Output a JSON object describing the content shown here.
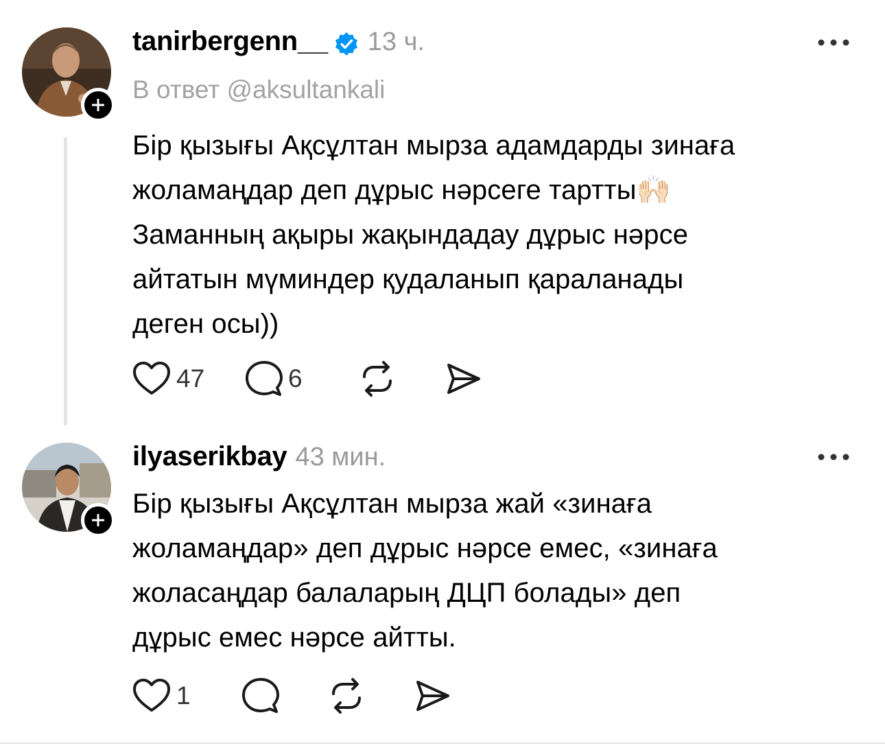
{
  "posts": [
    {
      "username": "tanirbergenn__",
      "verified": true,
      "time": "13 ч.",
      "reply_to": "В ответ @aksultankali",
      "lines": [
        "Бір қызығы Ақсұлтан мырза адамдарды зинаға",
        "жоламаңдар деп дұрыс нәрсеге тартты🙌🏻",
        "Заманның ақыры жақындадау дұрыс нәрсе",
        "айтатын мүминдер қудаланып қараланады",
        "деген осы))"
      ],
      "likes": "47",
      "comments": "6",
      "avatar_icon": "avatar-man-suit",
      "colors": {
        "avatar_bg": "#5a4230",
        "avatar_fg": "#8a5a36"
      }
    },
    {
      "username": "ilyaserikbay",
      "verified": false,
      "time": "43 мин.",
      "lines": [
        "Бір қызығы Ақсұлтан мырза жай «зинаға",
        "жоламаңдар» деп дұрыс нәрсе емес, «зинаға",
        "жоласаңдар балаларың ДЦП болады» деп",
        "дұрыс емес нәрсе айтты."
      ],
      "likes": "1",
      "comments": "",
      "avatar_icon": "avatar-man-street",
      "colors": {
        "avatar_bg": "#c8c4bc",
        "avatar_fg": "#2a2a2a"
      }
    }
  ],
  "icons": {
    "like": "heart-icon",
    "comment": "comment-bubble-icon",
    "repost": "repost-icon",
    "share": "share-send-icon",
    "more": "more-dots-icon",
    "follow": "plus-icon",
    "verified": "verified-badge-icon"
  },
  "colors": {
    "verified_blue": "#0095f6",
    "muted_text": "#9a9a9a",
    "thread_line": "#e3e3e3"
  }
}
